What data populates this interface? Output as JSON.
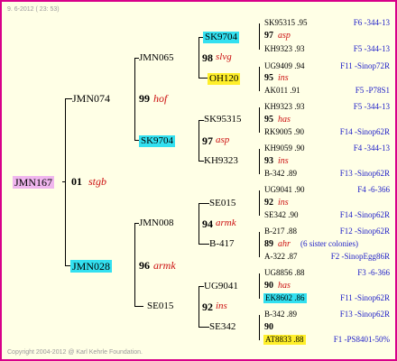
{
  "header": {
    "timestamp": "9.  6-2012 ( 23: 53)"
  },
  "footer": {
    "copyright": "Copyright 2004-2012 @ Karl Kehrle Foundation."
  },
  "colors": {
    "border": "#d8008a",
    "background": "#ffffe6",
    "highlight_pink": "#f0b6ee",
    "highlight_cyan": "#33e0f0",
    "highlight_yellow": "#ffef2a",
    "code_red": "#cc1010",
    "info_blue": "#1c1cc8"
  },
  "gen1": {
    "id": "JMN167",
    "year": "01",
    "code": "stgb"
  },
  "gen2": [
    {
      "id": "JMN074"
    },
    {
      "id": "JMN028"
    }
  ],
  "gen3": [
    {
      "id": "JMN065",
      "year": "99",
      "code": "hof"
    },
    {
      "id": "SK9704"
    },
    {
      "id": "JMN008",
      "year": "96",
      "code": "armk"
    },
    {
      "id": "SE015"
    }
  ],
  "gen4": [
    {
      "id": "SK9704",
      "year": "98",
      "code": "slvg"
    },
    {
      "id": "OH120"
    },
    {
      "id": "SK95315",
      "year": "97",
      "code": "asp"
    },
    {
      "id": "KH9323"
    },
    {
      "id": "SE015",
      "year": "94",
      "code": "armk"
    },
    {
      "id": "B-417"
    },
    {
      "id": "UG9041",
      "year": "92",
      "code": "ins"
    },
    {
      "id": "SE342"
    }
  ],
  "gen5": [
    {
      "year": "97",
      "code": "asp",
      "a": {
        "left": "SK95315 .95",
        "right": "F6 -344-13"
      },
      "b": {
        "left": "KH9323 .93",
        "right": "F5 -344-13"
      }
    },
    {
      "year": "95",
      "code": "ins",
      "a": {
        "left": "UG9409 .94",
        "right": "F11 -Sinop72R"
      },
      "b": {
        "left": "AK011 .91",
        "right": "F5 -P78S1"
      }
    },
    {
      "year": "95",
      "code": "has",
      "a": {
        "left": "KH9323 .93",
        "right": "F5 -344-13"
      },
      "b": {
        "left": "RK9005 .90",
        "right": "F14 -Sinop62R"
      }
    },
    {
      "year": "93",
      "code": "ins",
      "a": {
        "left": "KH9059 .90",
        "right": "F4 -344-13"
      },
      "b": {
        "left": "B-342 .89",
        "right": "F13 -Sinop62R"
      }
    },
    {
      "year": "92",
      "code": "ins",
      "a": {
        "left": "UG9041 .90",
        "right": "F4 -6-366"
      },
      "b": {
        "left": "SE342 .90",
        "right": "F14 -Sinop62R"
      }
    },
    {
      "year": "89",
      "code": "ahr",
      "note": "(6 sister colonies)",
      "a": {
        "left": "B-217 .88",
        "right": "F12 -Sinop62R"
      },
      "b": {
        "left": "A-322 .87",
        "right": "F2 -SinopEgg86R"
      }
    },
    {
      "year": "90",
      "code": "has",
      "a": {
        "left": "UG8856 .88",
        "right": "F3 -6-366"
      },
      "b": {
        "left": "EK8602 .86",
        "right": "F11 -Sinop62R"
      }
    },
    {
      "year": "90",
      "a": {
        "left": "B-342 .89",
        "right": "F13 -Sinop62R"
      },
      "b": {
        "left": "AT8833 .88",
        "right": "F1 -PS8401-50%"
      }
    }
  ]
}
